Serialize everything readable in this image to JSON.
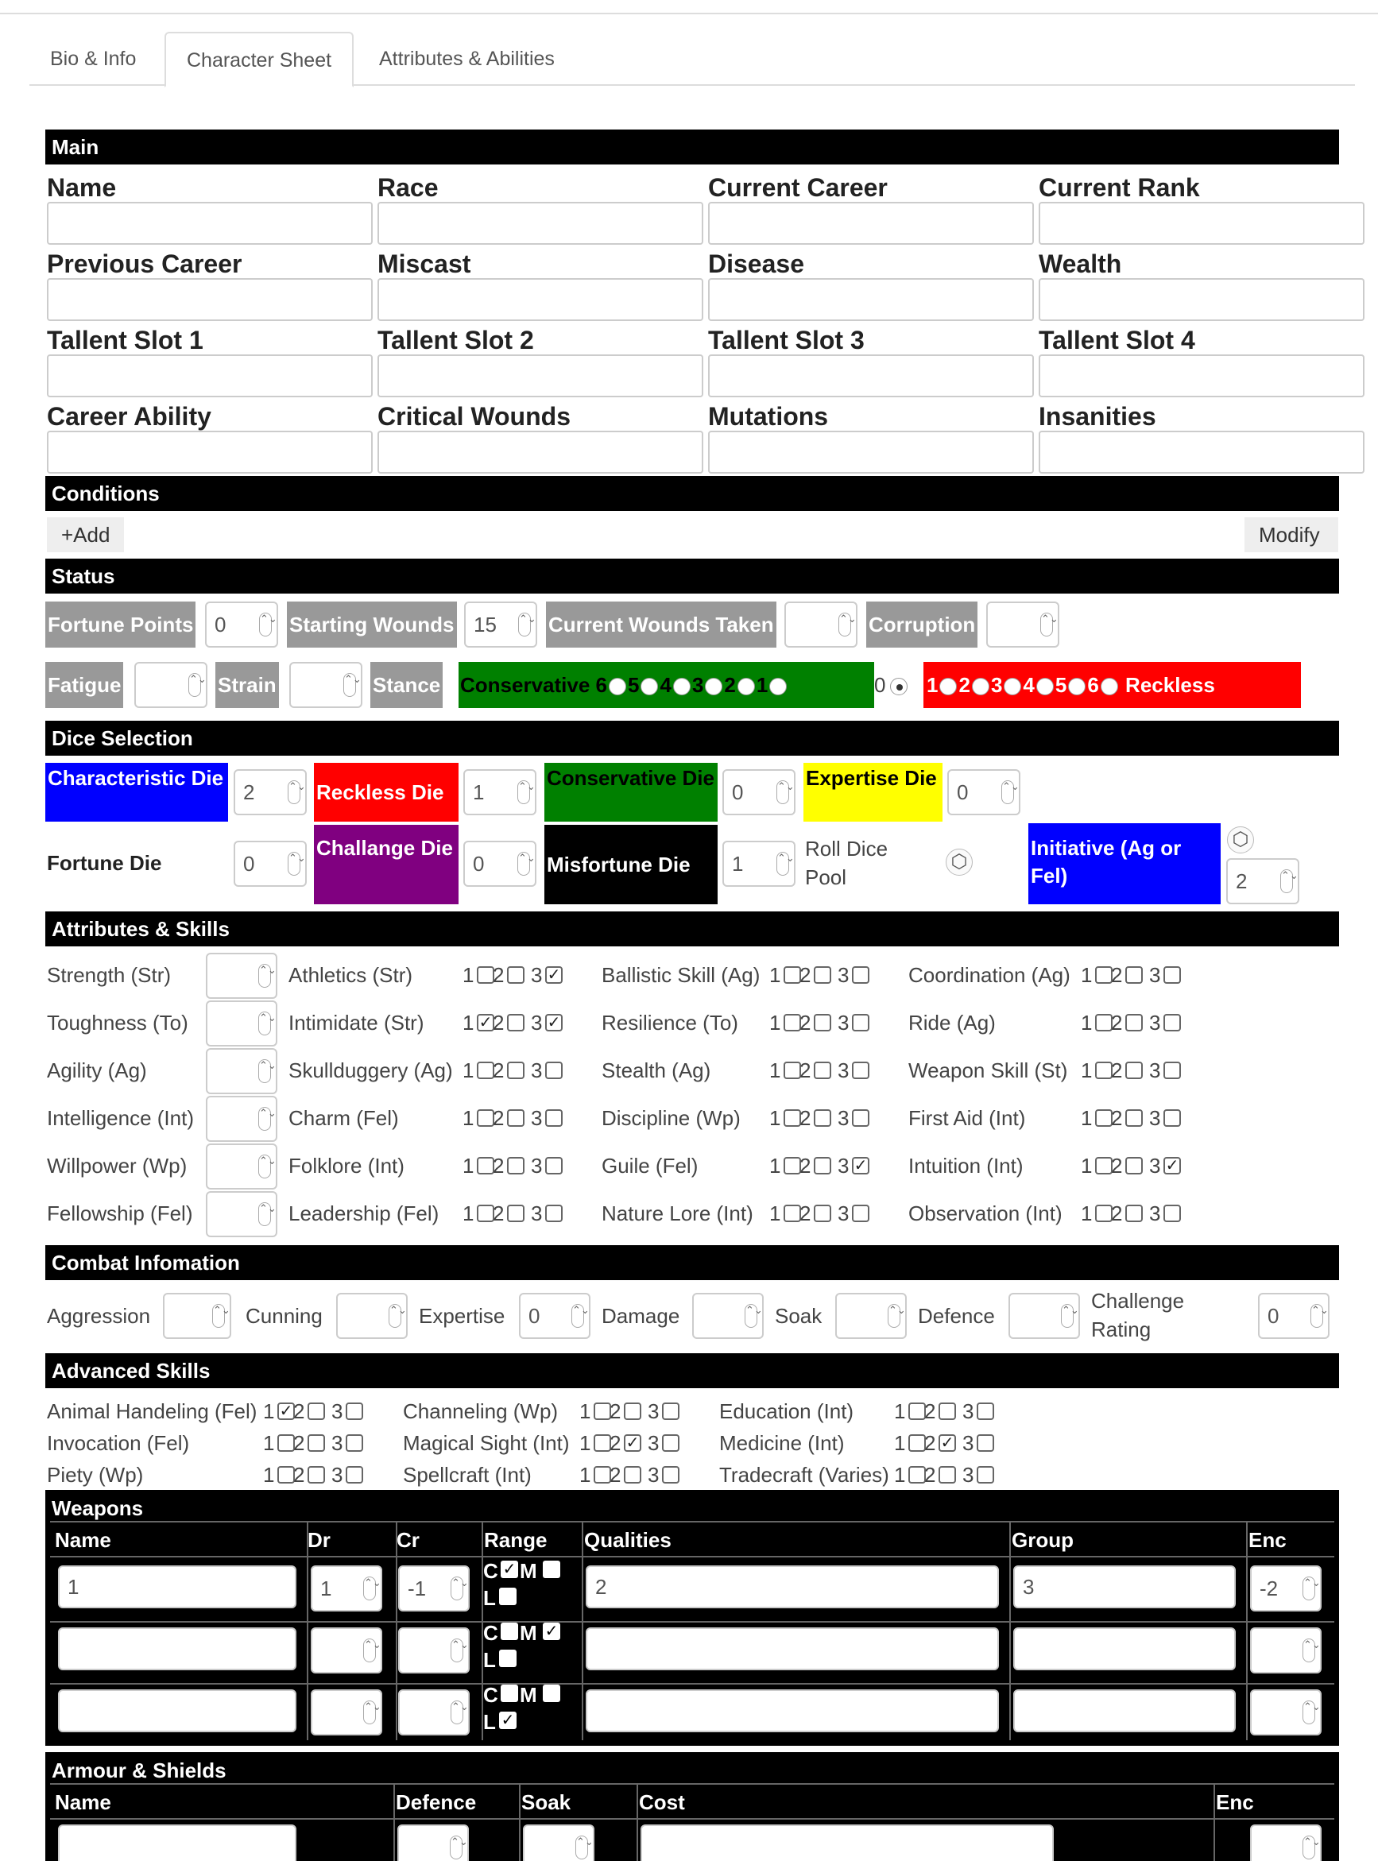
{
  "tabs": [
    "Bio & Info",
    "Character Sheet",
    "Attributes & Abilities"
  ],
  "sections": {
    "main": "Main",
    "conditions": "Conditions",
    "status": "Status",
    "dice": "Dice Selection",
    "attributes": "Attributes & Skills",
    "combat": "Combat Infomation",
    "advanced": "Advanced Skills",
    "weapons": "Weapons",
    "armour": "Armour & Shields"
  },
  "main_fields": [
    "Name",
    "Race",
    "Current Career",
    "Current Rank",
    "Previous Career",
    "Miscast",
    "Disease",
    "Wealth",
    "Tallent Slot 1",
    "Tallent Slot 2",
    "Tallent Slot 3",
    "Tallent Slot 4",
    "Career Ability",
    "Critical Wounds",
    "Mutations",
    "Insanities"
  ],
  "conditions": {
    "add": "+Add",
    "modify": "Modify"
  },
  "status": {
    "fortune_label": "Fortune Points",
    "fortune_value": "0",
    "starting_wounds_label": "Starting Wounds",
    "starting_wounds_value": "15",
    "current_wounds_label": "Current Wounds Taken",
    "corruption_label": "Corruption",
    "fatigue_label": "Fatigue",
    "strain_label": "Strain",
    "stance_label": "Stance",
    "conservative": "Conservative",
    "reckless": "Reckless",
    "cons_nums": [
      "6",
      "5",
      "4",
      "3",
      "2",
      "1"
    ],
    "zero": "0",
    "reck_nums": [
      "1",
      "2",
      "3",
      "4",
      "5",
      "6"
    ],
    "stance_selected": "0"
  },
  "dice": {
    "characteristic": "Characteristic Die",
    "characteristic_value": "2",
    "reckless": "Reckless Die",
    "reckless_value": "1",
    "conservative": "Conservative Die",
    "conservative_value": "0",
    "expertise": "Expertise Die",
    "expertise_value": "0",
    "fortune": "Fortune Die",
    "fortune_value": "0",
    "challange": "Challange Die",
    "challange_value": "0",
    "misfortune": "Misfortune Die",
    "misfortune_value": "1",
    "roll_pool": "Roll Dice Pool",
    "initiative": "Initiative (Ag or Fel)",
    "initiative_value": "2"
  },
  "attributes": [
    "Strength (Str)",
    "Toughness (To)",
    "Agility (Ag)",
    "Intelligence (Int)",
    "Willpower (Wp)",
    "Fellowship (Fel)"
  ],
  "skills": [
    [
      {
        "name": "Athletics (Str)",
        "checks": [
          false,
          false,
          true
        ]
      },
      {
        "name": "Ballistic Skill (Ag)",
        "checks": [
          false,
          false,
          false
        ]
      },
      {
        "name": "Coordination (Ag)",
        "checks": [
          false,
          false,
          false
        ]
      }
    ],
    [
      {
        "name": "Intimidate (Str)",
        "checks": [
          true,
          false,
          true
        ]
      },
      {
        "name": "Resilience (To)",
        "checks": [
          false,
          false,
          false
        ]
      },
      {
        "name": "Ride (Ag)",
        "checks": [
          false,
          false,
          false
        ]
      }
    ],
    [
      {
        "name": "Skullduggery (Ag)",
        "checks": [
          false,
          false,
          false
        ]
      },
      {
        "name": "Stealth (Ag)",
        "checks": [
          false,
          false,
          false
        ]
      },
      {
        "name": "Weapon Skill (St)",
        "checks": [
          false,
          false,
          false
        ]
      }
    ],
    [
      {
        "name": "Charm (Fel)",
        "checks": [
          false,
          false,
          false
        ]
      },
      {
        "name": "Discipline (Wp)",
        "checks": [
          false,
          false,
          false
        ]
      },
      {
        "name": "First Aid (Int)",
        "checks": [
          false,
          false,
          false
        ]
      }
    ],
    [
      {
        "name": "Folklore (Int)",
        "checks": [
          false,
          false,
          false
        ]
      },
      {
        "name": "Guile (Fel)",
        "checks": [
          false,
          false,
          true
        ]
      },
      {
        "name": "Intuition (Int)",
        "checks": [
          false,
          false,
          true
        ]
      }
    ],
    [
      {
        "name": "Leadership (Fel)",
        "checks": [
          false,
          false,
          false
        ]
      },
      {
        "name": "Nature Lore (Int)",
        "checks": [
          false,
          false,
          false
        ]
      },
      {
        "name": "Observation (Int)",
        "checks": [
          false,
          false,
          false
        ]
      }
    ]
  ],
  "combat": {
    "aggression": "Aggression",
    "cunning": "Cunning",
    "expertise": "Expertise",
    "expertise_value": "0",
    "damage": "Damage",
    "soak": "Soak",
    "defence": "Defence",
    "challenge": "Challenge Rating",
    "challenge_value": "0"
  },
  "advanced": [
    [
      {
        "name": "Animal Handeling (Fel)",
        "checks": [
          true,
          false,
          false
        ]
      },
      {
        "name": "Channeling (Wp)",
        "checks": [
          false,
          false,
          false
        ]
      },
      {
        "name": "Education (Int)",
        "checks": [
          false,
          false,
          false
        ]
      }
    ],
    [
      {
        "name": "Invocation (Fel)",
        "checks": [
          false,
          false,
          false
        ]
      },
      {
        "name": "Magical Sight (Int)",
        "checks": [
          false,
          true,
          false
        ]
      },
      {
        "name": "Medicine (Int)",
        "checks": [
          false,
          true,
          false
        ]
      }
    ],
    [
      {
        "name": "Piety (Wp)",
        "checks": [
          false,
          false,
          false
        ]
      },
      {
        "name": "Spellcraft (Int)",
        "checks": [
          false,
          false,
          false
        ]
      },
      {
        "name": "Tradecraft (Varies)",
        "checks": [
          false,
          false,
          false
        ]
      }
    ]
  ],
  "weapons": {
    "headers": [
      "Name",
      "Dr",
      "Cr",
      "Range",
      "Qualities",
      "Group",
      "Enc"
    ],
    "rows": [
      {
        "name": "1",
        "dr": "1",
        "cr": "-1",
        "c": true,
        "m": false,
        "l": false,
        "qualities": "2",
        "group": "3",
        "enc": "-2"
      },
      {
        "name": "",
        "dr": "",
        "cr": "",
        "c": false,
        "m": true,
        "l": false,
        "qualities": "",
        "group": "",
        "enc": ""
      },
      {
        "name": "",
        "dr": "",
        "cr": "",
        "c": false,
        "m": false,
        "l": true,
        "qualities": "",
        "group": "",
        "enc": ""
      }
    ],
    "range_c": "C",
    "range_m": "M",
    "range_l": "L"
  },
  "armour": {
    "headers": [
      "Name",
      "Defence",
      "Soak",
      "Cost",
      "Enc"
    ]
  },
  "nums": [
    "1",
    "2",
    "3"
  ],
  "spin": "⌃⌄",
  "check_mark": "✓",
  "d20_icon": "⬡"
}
